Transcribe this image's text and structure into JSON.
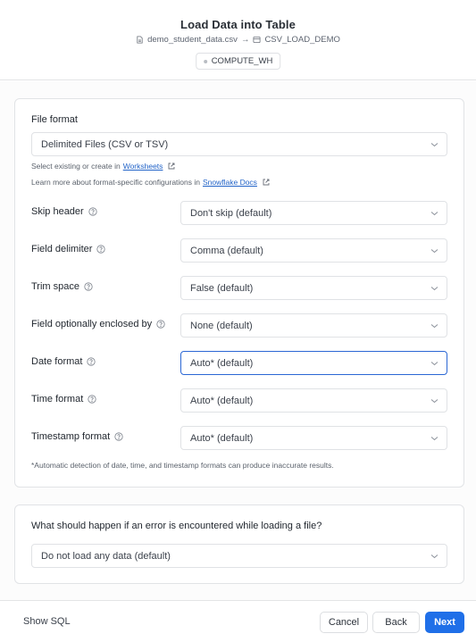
{
  "header": {
    "title": "Load Data into Table",
    "source_file": "demo_student_data.csv",
    "arrow": "→",
    "target_table": "CSV_LOAD_DEMO",
    "warehouse": "COMPUTE_WH"
  },
  "file_format": {
    "label": "File format",
    "value": "Delimited Files (CSV or TSV)",
    "hint1_prefix": "Select existing or create in ",
    "hint1_link": "Worksheets",
    "hint2_prefix": "Learn more about format-specific configurations in ",
    "hint2_link": "Snowflake Docs"
  },
  "options": [
    {
      "label": "Skip header",
      "value": "Don't skip (default)",
      "focused": false
    },
    {
      "label": "Field delimiter",
      "value": "Comma (default)",
      "focused": false
    },
    {
      "label": "Trim space",
      "value": "False (default)",
      "focused": false
    },
    {
      "label": "Field optionally enclosed by",
      "value": "None (default)",
      "focused": false
    },
    {
      "label": "Date format",
      "value": "Auto* (default)",
      "focused": true
    },
    {
      "label": "Time format",
      "value": "Auto* (default)",
      "focused": false
    },
    {
      "label": "Timestamp format",
      "value": "Auto* (default)",
      "focused": false
    }
  ],
  "auto_note": "*Automatic detection of date, time, and timestamp formats can produce inaccurate results.",
  "on_error": {
    "question": "What should happen if an error is encountered while loading a file?",
    "value": "Do not load any data (default)"
  },
  "footer": {
    "show_sql": "Show SQL",
    "cancel": "Cancel",
    "back": "Back",
    "next": "Next"
  },
  "colors": {
    "accent": "#1f6fe8",
    "focus_border": "#2b67d4",
    "link": "#2364c8"
  }
}
